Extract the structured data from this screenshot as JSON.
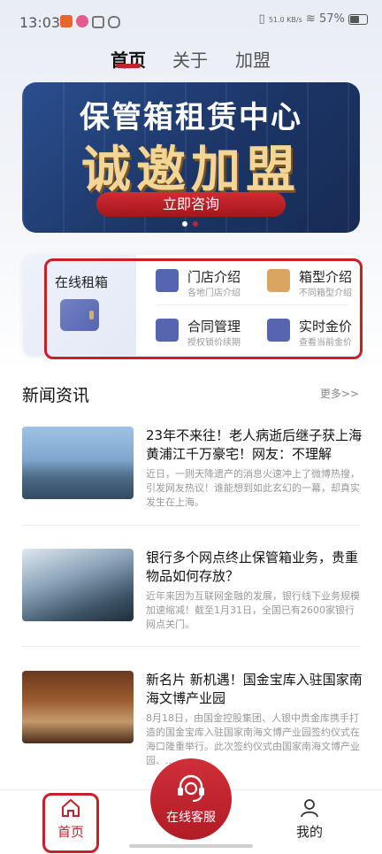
{
  "status_bar": {
    "time": "13:03",
    "network": "51.0 KB/s",
    "battery": "57%"
  },
  "top_tabs": [
    "首页",
    "关于",
    "加盟"
  ],
  "banner": {
    "line1": "保管箱租赁中心",
    "line2": "诚邀加盟",
    "cta": "立即咨询"
  },
  "quick": {
    "rent_label": "在线租箱",
    "items": [
      {
        "title": "门店介绍",
        "sub": "各地门店介绍",
        "icon": "document-icon"
      },
      {
        "title": "箱型介绍",
        "sub": "不同箱型介绍",
        "icon": "safe-box-icon"
      },
      {
        "title": "合同管理",
        "sub": "授权锁价续期",
        "icon": "briefcase-icon"
      },
      {
        "title": "实时金价",
        "sub": "查看当前金价",
        "icon": "calculator-icon"
      }
    ]
  },
  "news_section": {
    "title": "新闻资讯",
    "more": "更多>>"
  },
  "news": [
    {
      "title": "23年不来往！老人病逝后继子获上海黄浦江千万豪宅！网友：不理解",
      "summary": "近日，一则天降遗产的消息火速冲上了微博热搜，引发网友热议！谁能想到如此玄幻的一幕，却真实发生在上海。"
    },
    {
      "title": "银行多个网点终止保管箱业务，贵重物品如何存放？",
      "summary": "近年来因为互联网金融的发展，银行线下业务规模加速缩减！截至1月31日，全国已有2600家银行网点关门。"
    },
    {
      "title": "新名片 新机遇！国金宝库入驻国家南海文博产业园",
      "summary": "8月18日，由国金控股集团、人银中贵金库携手打造的国金宝库入驻国家南海文博产业园签约仪式在海口隆重举行。此次签约仪式由国家南海文博产业园、..."
    }
  ],
  "tabbar": {
    "home": "首页",
    "service": "在线客服",
    "mine": "我的"
  },
  "colors": {
    "accent": "#c0242c",
    "banner_gold": "#f3d596",
    "panel_blue": "#5565b0"
  }
}
